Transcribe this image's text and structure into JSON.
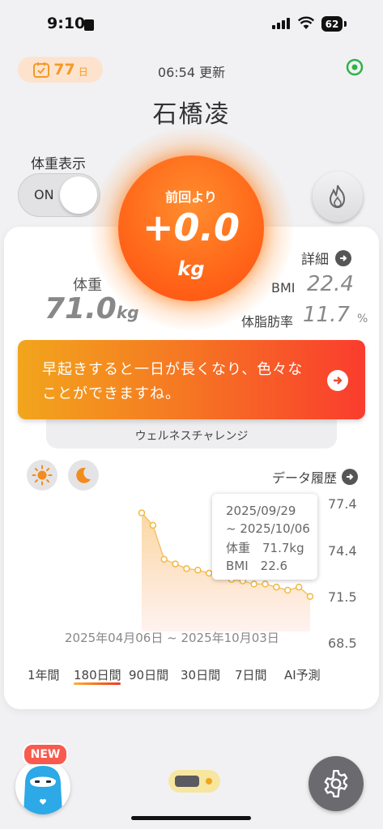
{
  "status_bar": {
    "time": "9:10",
    "battery": "62"
  },
  "header": {
    "days_count": "77",
    "days_unit": "日",
    "update_time": "06:54 更新",
    "user_name": "石橋凌"
  },
  "weight_display": {
    "label": "体重表示",
    "toggle_text": "ON"
  },
  "change_circle": {
    "since_label": "前回より",
    "delta": "+0.0",
    "unit": "kg"
  },
  "stats": {
    "weight_label": "体重",
    "weight_value": "71.0",
    "weight_unit": "kg",
    "detail_label": "詳細",
    "bmi_label": "BMI",
    "bmi_value": "22.4",
    "fat_label": "体脂肪率",
    "fat_value": "11.7",
    "fat_unit": "%"
  },
  "banner": {
    "text": "早起きすると一日が長くなり、色々なことができますね。"
  },
  "challenge": {
    "label": "ウェルネスチャレンジ"
  },
  "chart_header": {
    "history_label": "データ履歴"
  },
  "tooltip": {
    "date_start": "2025/09/29",
    "date_end": "~ 2025/10/06",
    "weight_line": "体重　71.7kg",
    "bmi_line": "BMI　22.6"
  },
  "chart_data": {
    "type": "area",
    "x": [
      "p1",
      "p2",
      "p3",
      "p4",
      "p5",
      "p6",
      "p7",
      "p8",
      "p9",
      "p10",
      "p11",
      "p12",
      "p13",
      "p14",
      "p15",
      "p16"
    ],
    "values": [
      76.9,
      76.1,
      73.9,
      73.6,
      73.3,
      73.2,
      73.0,
      72.8,
      72.6,
      72.5,
      72.3,
      72.3,
      72.1,
      71.9,
      72.1,
      71.5
    ],
    "yticks": [
      "77.4",
      "74.4",
      "71.5",
      "68.5"
    ],
    "ylim": [
      68.5,
      77.4
    ],
    "date_range": "2025年04月06日 ~ 2025年10月03日",
    "colors": {
      "line": "#f5c26b",
      "point_stroke": "#f2b840",
      "fill_top": "#fbd7a5",
      "fill_bottom": "#fff2f0"
    }
  },
  "periods": [
    "1年間",
    "180日間",
    "90日間",
    "30日間",
    "7日間",
    "AI予測"
  ],
  "bottom": {
    "new_badge": "NEW"
  }
}
